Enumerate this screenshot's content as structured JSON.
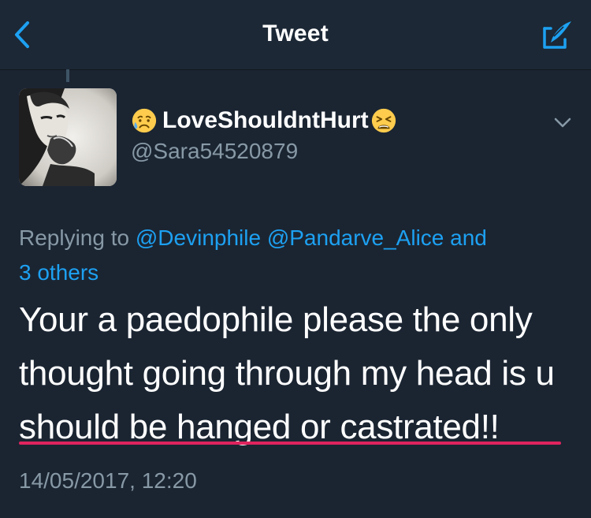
{
  "header": {
    "title": "Tweet",
    "back_icon": "chevron-left-icon",
    "compose_icon": "compose-tweet-icon",
    "accent_color": "#1da1f2"
  },
  "tweet": {
    "author": {
      "display_name": "LoveShouldntHurt",
      "name_emoji_before": "disappointed-relieved-emoji",
      "name_emoji_after": "weary-face-emoji",
      "handle": "@Sara54520879",
      "avatar": "profile-photo"
    },
    "reply_context": {
      "prefix": "Replying to ",
      "mentions": [
        "@Devinphile",
        "@Pandarve_Alice"
      ],
      "joiner": " and",
      "others": "3 others"
    },
    "text": "Your a paedophile please the only thought going through my head is u should be hanged or castrated!!",
    "timestamp": "14/05/2017, 12:20",
    "highlight_color": "#e0245e"
  }
}
